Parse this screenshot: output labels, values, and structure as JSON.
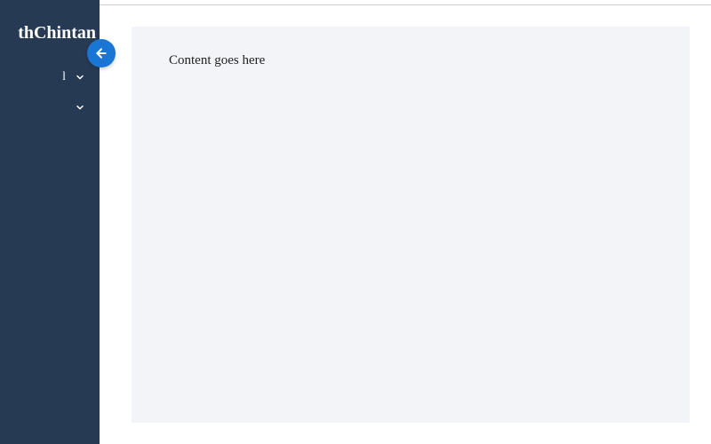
{
  "brand": "thChintan",
  "sidebar": {
    "items": [
      {
        "label": "l"
      },
      {
        "label": ""
      }
    ]
  },
  "toggle_icon": "arrow-left",
  "main": {
    "content": "Content goes here"
  },
  "colors": {
    "sidebar_bg": "#273a53",
    "toggle_bg": "#1976d2",
    "content_bg": "#f2f4f7"
  }
}
